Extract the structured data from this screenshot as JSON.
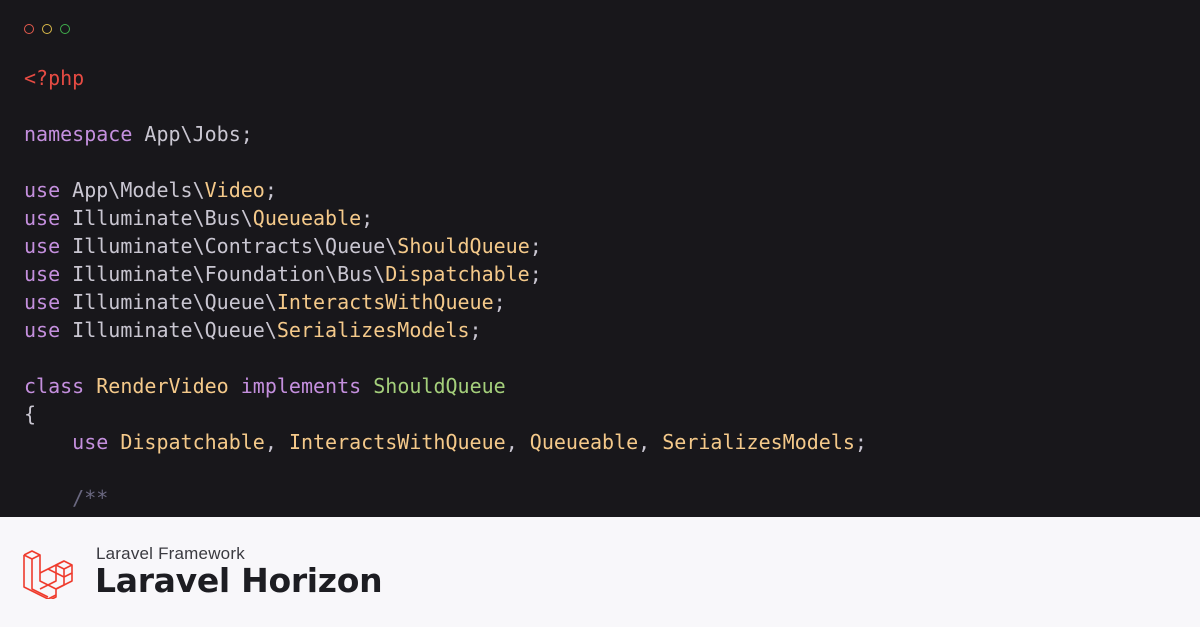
{
  "window": {
    "controls": [
      "close",
      "minimize",
      "maximize"
    ]
  },
  "code": {
    "lines": [
      [
        {
          "t": "<?php",
          "c": "open"
        }
      ],
      [],
      [
        {
          "t": "namespace",
          "c": "kw"
        },
        {
          "t": " App\\Jobs;",
          "c": "plain"
        }
      ],
      [],
      [
        {
          "t": "use",
          "c": "kw"
        },
        {
          "t": " App\\Models\\",
          "c": "plain"
        },
        {
          "t": "Video",
          "c": "cls"
        },
        {
          "t": ";",
          "c": "plain"
        }
      ],
      [
        {
          "t": "use",
          "c": "kw"
        },
        {
          "t": " Illuminate\\Bus\\",
          "c": "plain"
        },
        {
          "t": "Queueable",
          "c": "cls"
        },
        {
          "t": ";",
          "c": "plain"
        }
      ],
      [
        {
          "t": "use",
          "c": "kw"
        },
        {
          "t": " Illuminate\\Contracts\\Queue\\",
          "c": "plain"
        },
        {
          "t": "ShouldQueue",
          "c": "cls"
        },
        {
          "t": ";",
          "c": "plain"
        }
      ],
      [
        {
          "t": "use",
          "c": "kw"
        },
        {
          "t": " Illuminate\\Foundation\\Bus\\",
          "c": "plain"
        },
        {
          "t": "Dispatchable",
          "c": "cls"
        },
        {
          "t": ";",
          "c": "plain"
        }
      ],
      [
        {
          "t": "use",
          "c": "kw"
        },
        {
          "t": " Illuminate\\Queue\\",
          "c": "plain"
        },
        {
          "t": "InteractsWithQueue",
          "c": "cls"
        },
        {
          "t": ";",
          "c": "plain"
        }
      ],
      [
        {
          "t": "use",
          "c": "kw"
        },
        {
          "t": " Illuminate\\Queue\\",
          "c": "plain"
        },
        {
          "t": "SerializesModels",
          "c": "cls"
        },
        {
          "t": ";",
          "c": "plain"
        }
      ],
      [],
      [
        {
          "t": "class",
          "c": "kw"
        },
        {
          "t": " ",
          "c": "plain"
        },
        {
          "t": "RenderVideo",
          "c": "cls"
        },
        {
          "t": " ",
          "c": "plain"
        },
        {
          "t": "implements",
          "c": "kw"
        },
        {
          "t": " ",
          "c": "plain"
        },
        {
          "t": "ShouldQueue",
          "c": "iface"
        }
      ],
      [
        {
          "t": "{",
          "c": "plain"
        }
      ],
      [
        {
          "t": "    ",
          "c": "plain"
        },
        {
          "t": "use",
          "c": "kw"
        },
        {
          "t": " ",
          "c": "plain"
        },
        {
          "t": "Dispatchable",
          "c": "cls"
        },
        {
          "t": ", ",
          "c": "plain"
        },
        {
          "t": "InteractsWithQueue",
          "c": "cls"
        },
        {
          "t": ", ",
          "c": "plain"
        },
        {
          "t": "Queueable",
          "c": "cls"
        },
        {
          "t": ", ",
          "c": "plain"
        },
        {
          "t": "SerializesModels",
          "c": "cls"
        },
        {
          "t": ";",
          "c": "plain"
        }
      ],
      [],
      [
        {
          "t": "    ",
          "c": "plain"
        },
        {
          "t": "/**",
          "c": "cmt"
        }
      ]
    ]
  },
  "footer": {
    "subtitle": "Laravel Framework",
    "title": "Laravel Horizon"
  },
  "colors": {
    "background": "#18171b",
    "keyword": "#c48fde",
    "class_name": "#f4c98a",
    "interface": "#a4cf7b",
    "php_open_tag": "#e64b43",
    "comment": "#6a6880",
    "footer_bg": "#f8f7fa",
    "logo": "#ef3b2d"
  },
  "icons": {
    "logo": "laravel-logo-icon"
  }
}
